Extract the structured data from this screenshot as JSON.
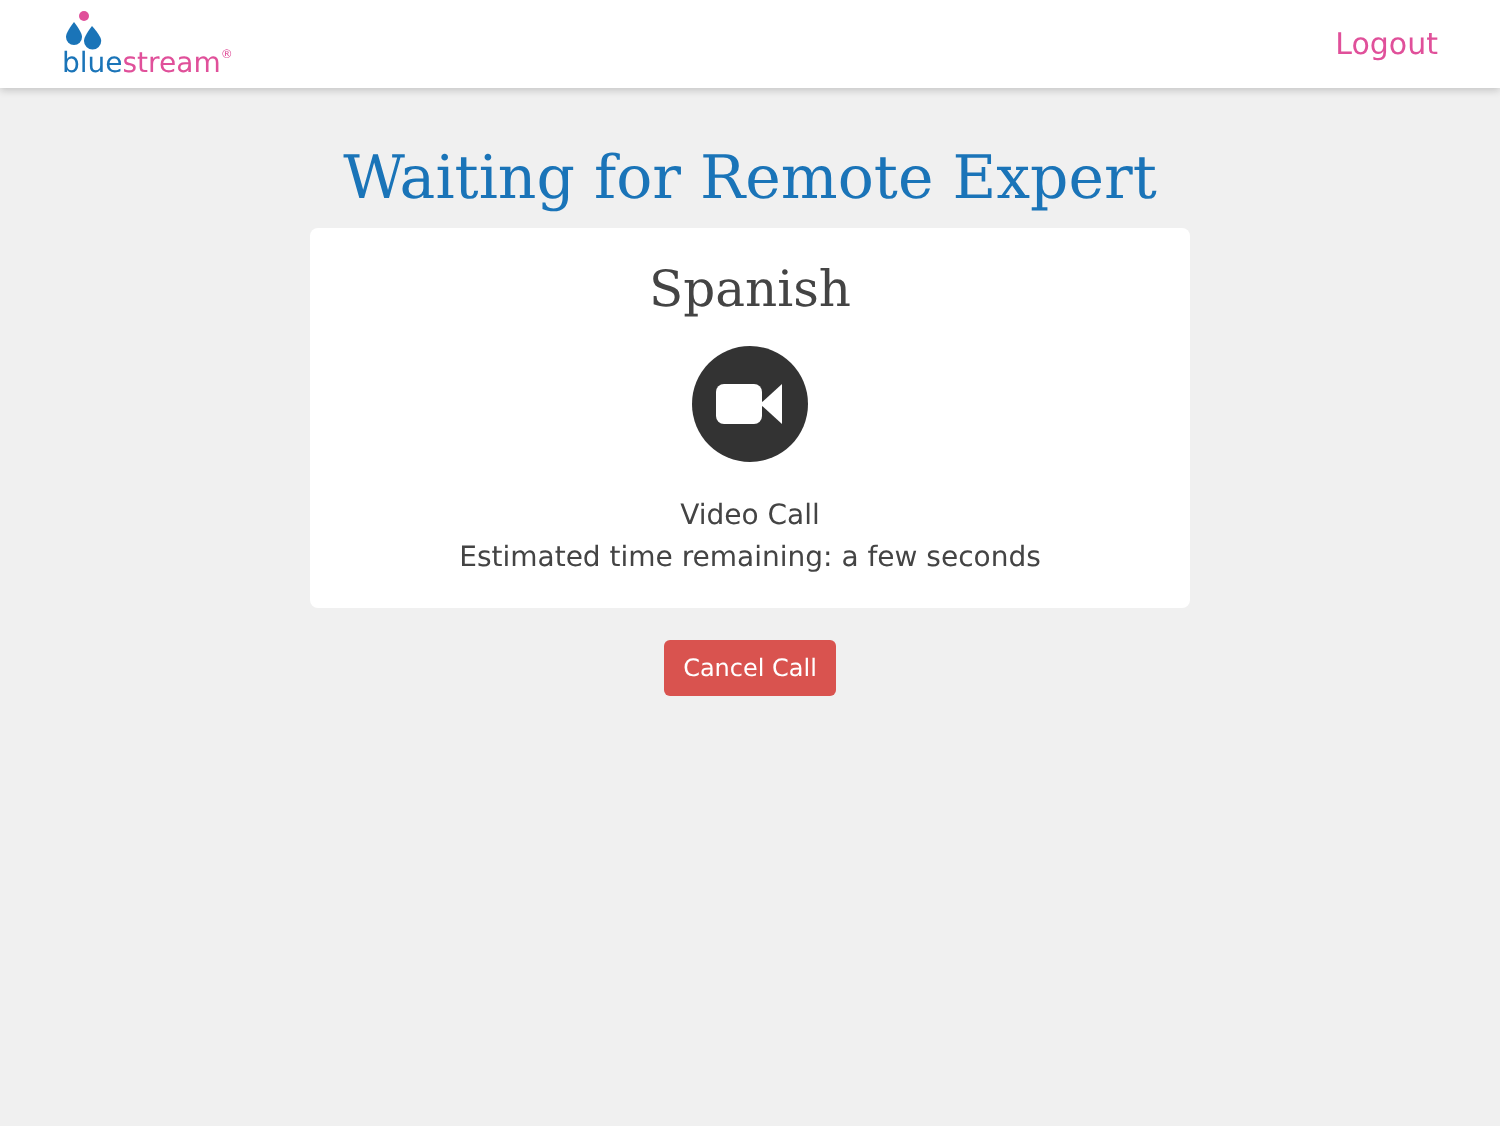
{
  "header": {
    "logo": [
      {
        "text": "blue",
        "color": "#1a74b8"
      },
      {
        "text": "stream",
        "color": "#e0509a"
      }
    ],
    "logo_mark": "®",
    "logout": "Logout"
  },
  "title": "Waiting for Remote Expert",
  "card": {
    "language": "Spanish",
    "call_type": "Video Call",
    "estimate": "Estimated time remaining: a few seconds"
  },
  "cancel_button": "Cancel Call"
}
